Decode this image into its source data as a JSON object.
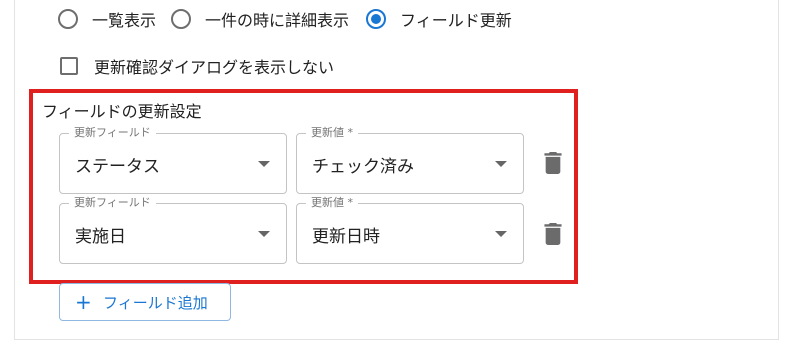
{
  "display_mode": {
    "options": [
      {
        "label": "一覧表示",
        "selected": false
      },
      {
        "label": "一件の時に詳細表示",
        "selected": false
      },
      {
        "label": "フィールド更新",
        "selected": true
      }
    ]
  },
  "confirm_dialog": {
    "label": "更新確認ダイアログを表示しない",
    "checked": false
  },
  "field_update": {
    "title": "フィールドの更新設定",
    "rows": [
      {
        "field_label": "更新フィールド",
        "field_value": "ステータス",
        "value_label": "更新値 *",
        "value_value": "チェック済み"
      },
      {
        "field_label": "更新フィールド",
        "field_value": "実施日",
        "value_label": "更新値 *",
        "value_value": "更新日時"
      }
    ],
    "add_button_label": "フィールド追加"
  },
  "icons": {
    "delete": "trash-icon",
    "add": "plus-icon"
  },
  "colors": {
    "accent": "#1976d2",
    "highlight_border": "#e0201f"
  }
}
